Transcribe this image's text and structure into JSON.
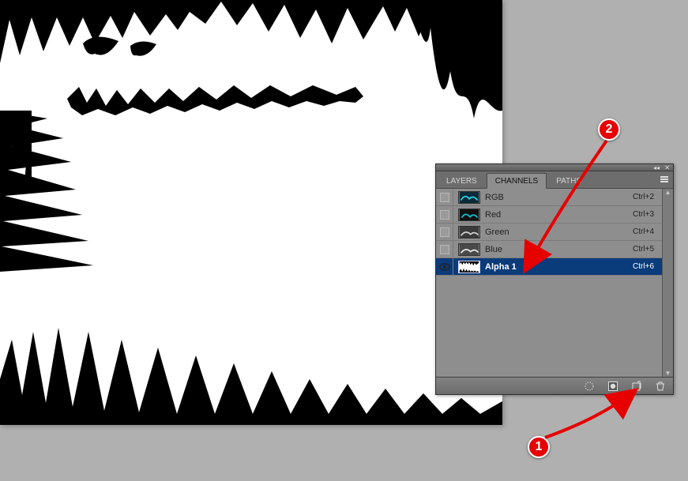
{
  "tabs": {
    "layers": "LAYERS",
    "channels": "CHANNELS",
    "paths": "PATHS"
  },
  "channels": [
    {
      "name": "RGB",
      "shortcut": "Ctrl+2",
      "visible": false,
      "selected": false,
      "thumb": "rgb"
    },
    {
      "name": "Red",
      "shortcut": "Ctrl+3",
      "visible": false,
      "selected": false,
      "thumb": "red"
    },
    {
      "name": "Green",
      "shortcut": "Ctrl+4",
      "visible": false,
      "selected": false,
      "thumb": "gray"
    },
    {
      "name": "Blue",
      "shortcut": "Ctrl+5",
      "visible": false,
      "selected": false,
      "thumb": "gray"
    },
    {
      "name": "Alpha 1",
      "shortcut": "Ctrl+6",
      "visible": true,
      "selected": true,
      "thumb": "alpha"
    }
  ],
  "icons": {
    "load_selection": "load-selection-icon",
    "save_selection": "save-selection-mask-icon",
    "new_channel": "new-channel-icon",
    "delete_channel": "delete-icon"
  },
  "annotations": {
    "1": "1",
    "2": "2"
  }
}
